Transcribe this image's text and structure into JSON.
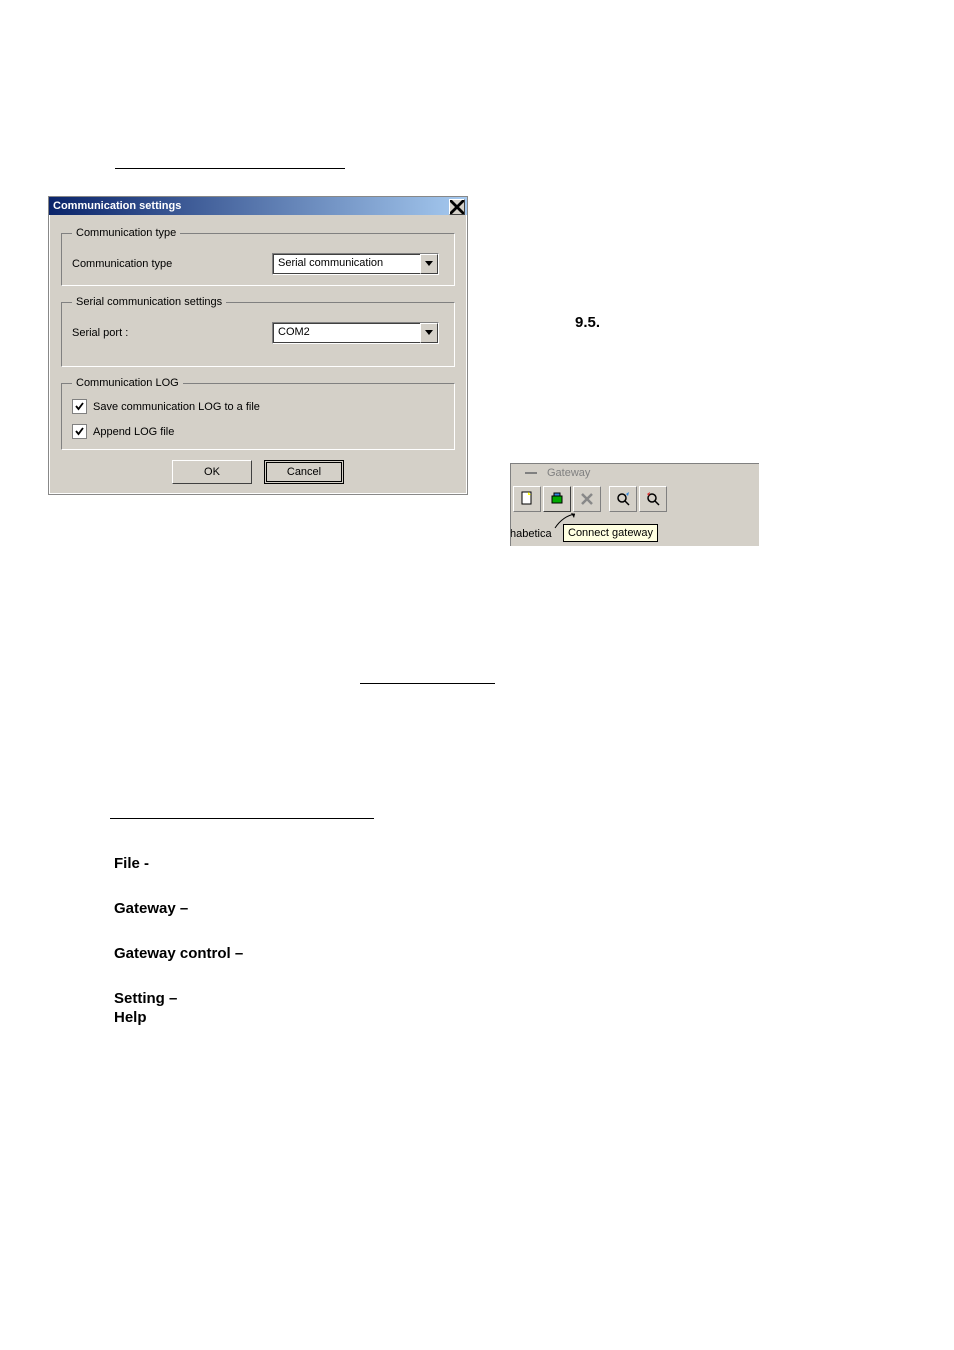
{
  "dialog": {
    "title": "Communication settings",
    "group_type": {
      "legend": "Communication type",
      "label": "Communication type",
      "value": "Serial communication"
    },
    "group_serial": {
      "legend": "Serial communication settings",
      "label": "Serial port :",
      "value": "COM2"
    },
    "group_log": {
      "legend": "Communication LOG",
      "save_label": "Save communication LOG to a file",
      "append_label": "Append LOG file"
    },
    "ok_label": "OK",
    "cancel_label": "Cancel"
  },
  "section_num": "9.5.",
  "snippet": {
    "menu_label": "Gateway",
    "left_text": "habetica",
    "tooltip": "Connect gateway"
  },
  "labels": {
    "file": "File -",
    "gateway": "Gateway –",
    "gateway_control": "Gateway control –",
    "setting": "Setting –",
    "help": "Help"
  }
}
